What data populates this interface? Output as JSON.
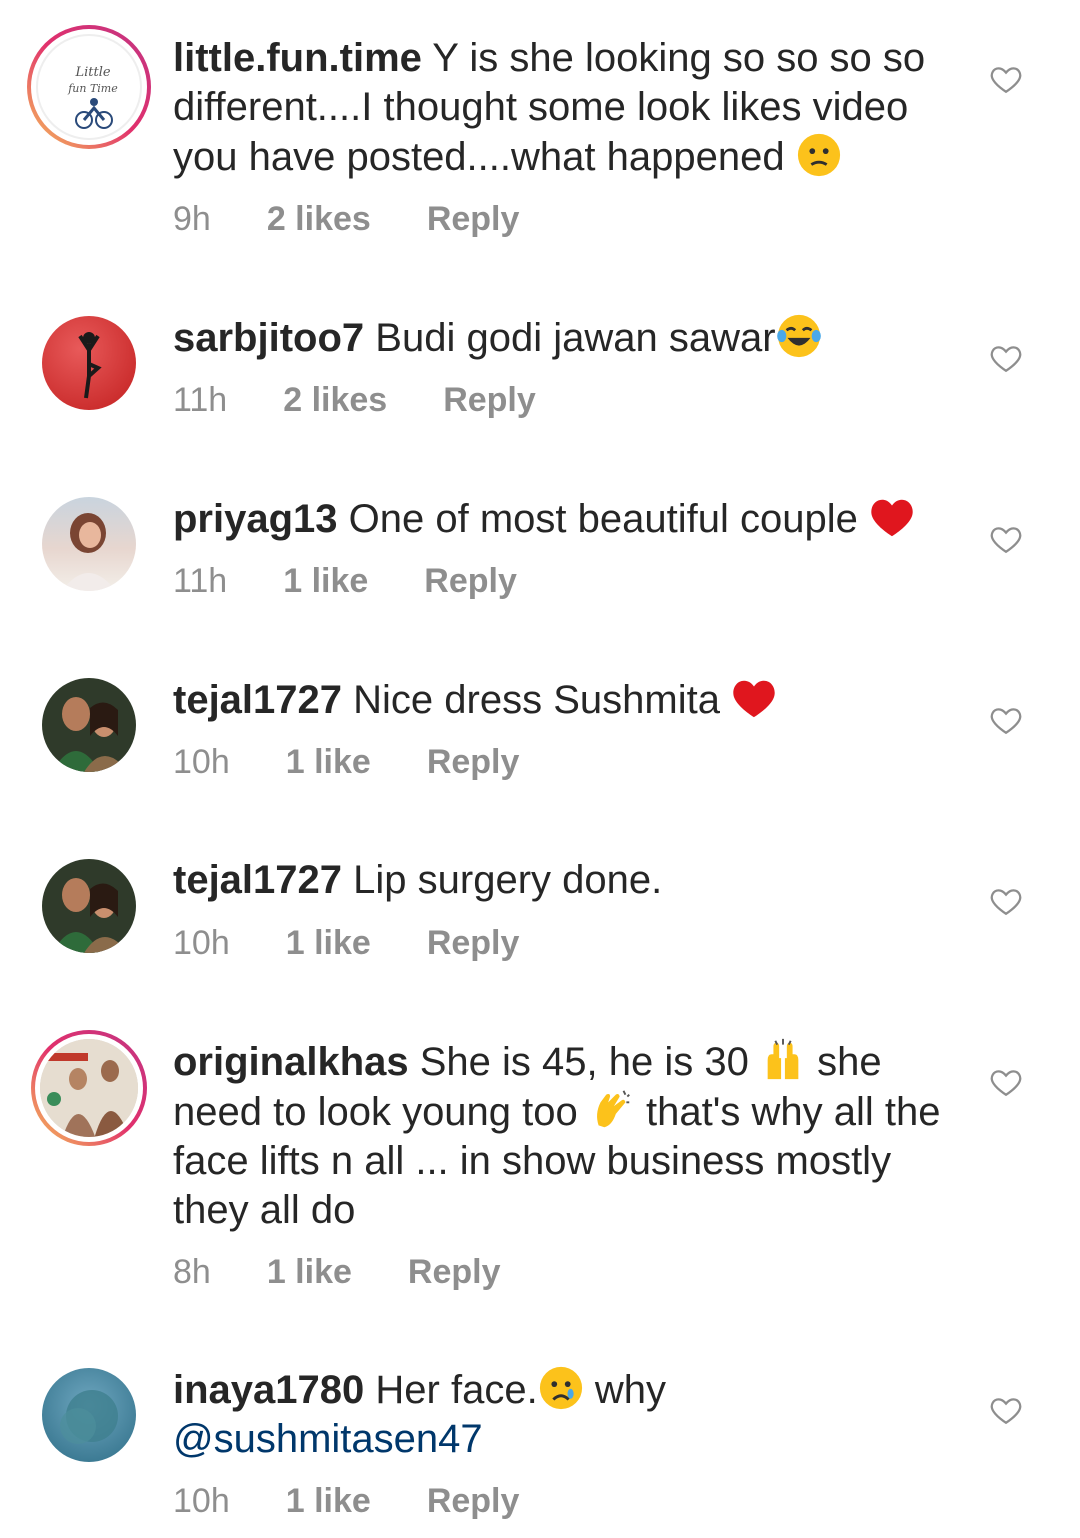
{
  "comments": [
    {
      "username": "little.fun.time",
      "text": "Y is she looking so so so so different....I thought some look likes video you have posted....what happened",
      "time": "9h",
      "likes": "2 likes",
      "reply": "Reply",
      "avatar": "logo-avatar"
    },
    {
      "username": "sarbjitoo7",
      "text": "Budi godi jawan sawar",
      "time": "11h",
      "likes": "2 likes",
      "reply": "Reply",
      "avatar": "yoga-silhouette-avatar"
    },
    {
      "username": "priyag13",
      "text": "One of most beautiful couple",
      "time": "11h",
      "likes": "1 like",
      "reply": "Reply",
      "avatar": "portrait-avatar"
    },
    {
      "username": "tejal1727",
      "text": "Nice dress Sushmita",
      "time": "10h",
      "likes": "1 like",
      "reply": "Reply",
      "avatar": "couple-avatar"
    },
    {
      "username": "tejal1727",
      "text": "Lip surgery done.",
      "time": "10h",
      "likes": "1 like",
      "reply": "Reply",
      "avatar": "couple-avatar"
    },
    {
      "username": "originalkhas",
      "text_1": "She is 45, he is 30",
      "text_2": "she need to look young too",
      "text_3": "that's why all the face lifts n all ... in show business mostly they  all do",
      "time": "8h",
      "likes": "1 like",
      "reply": "Reply",
      "avatar": "magazine-avatar"
    },
    {
      "username": "inaya1780",
      "text": "Her face.",
      "text_2": "why",
      "mention": "@sushmitasen47",
      "time": "10h",
      "likes": "1 like",
      "reply": "Reply",
      "avatar": "tree-avatar"
    }
  ],
  "emoji": {
    "c1": "confused-face",
    "c2": "tears-of-joy",
    "c3": "red-heart",
    "c4": "red-heart",
    "c6a": "raising-hands",
    "c6b": "clapping-hands",
    "c7": "crying-face"
  },
  "colors": {
    "username": "#262626",
    "meta": "#8e8e8e",
    "mention": "#00376b",
    "heart": "#ed4956"
  }
}
